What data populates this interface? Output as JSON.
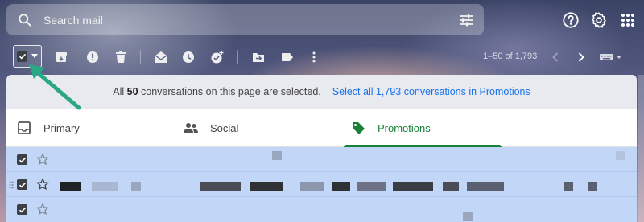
{
  "search": {
    "placeholder": "Search mail"
  },
  "toolbar": {
    "range_text": "1–50 of 1,793"
  },
  "banner": {
    "prefix": "All",
    "count": "50",
    "suffix": "conversations on this page are selected.",
    "link": "Select all 1,793 conversations in Promotions"
  },
  "tabs": [
    {
      "label": "Primary",
      "active": false
    },
    {
      "label": "Social",
      "active": false
    },
    {
      "label": "Promotions",
      "active": true
    }
  ],
  "colors": {
    "accent_green": "#188038",
    "link_blue": "#1a73e8",
    "selected_row": "#c2d7f7",
    "arrow": "#2aa786"
  },
  "icons": [
    "search-icon",
    "tune-icon",
    "help-icon",
    "settings-icon",
    "apps-icon",
    "select-checkbox-icon",
    "archive-icon",
    "report-spam-icon",
    "delete-icon",
    "mark-read-icon",
    "snooze-icon",
    "add-task-icon",
    "move-to-icon",
    "label-icon",
    "more-icon",
    "prev-page-icon",
    "next-page-icon",
    "keyboard-icon",
    "inbox-icon",
    "people-icon",
    "tag-icon",
    "star-icon"
  ]
}
